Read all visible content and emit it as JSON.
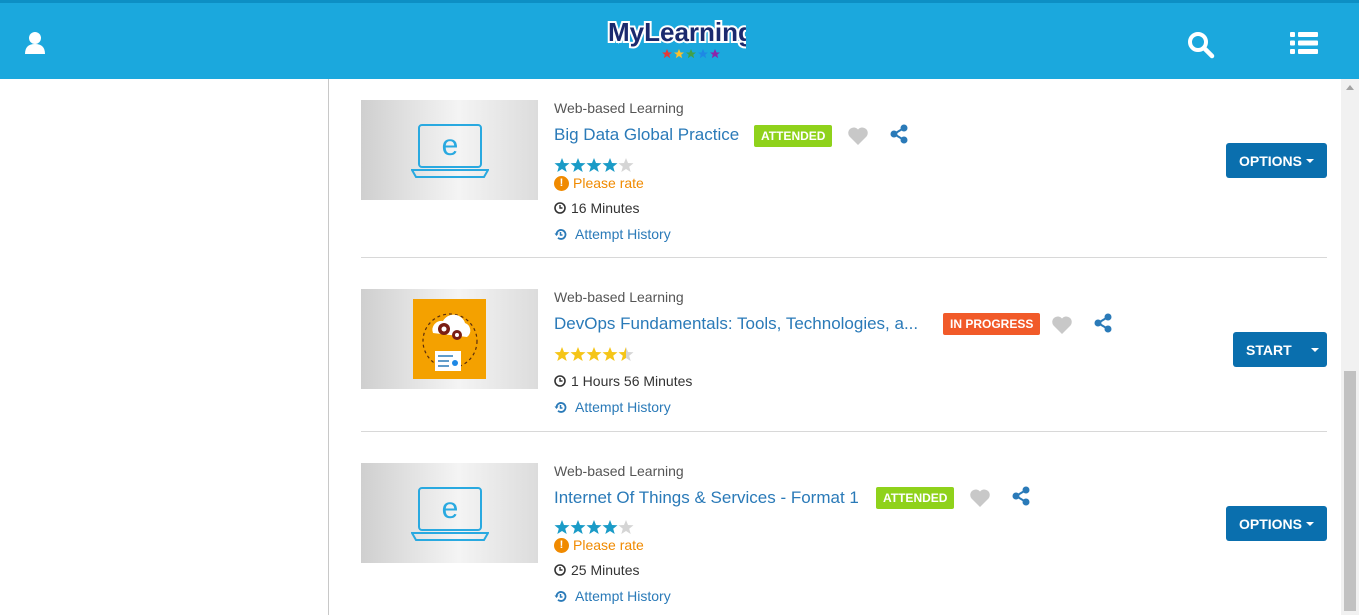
{
  "header": {
    "logo_text": "MyLearning",
    "brand_color": "#1ba8dd"
  },
  "courses": [
    {
      "type": "Web-based Learning",
      "title": "Big Data Global Practice",
      "status": "ATTENDED",
      "rating": 4,
      "rating_max": 5,
      "rate_prompt": "Please rate",
      "duration": "16 Minutes",
      "history": "Attempt History",
      "action": "OPTIONS",
      "thumbnail": "e-learning-laptop-icon"
    },
    {
      "type": "Web-based Learning",
      "title": "DevOps Fundamentals: Tools, Technologies, a...",
      "status": "IN PROGRESS",
      "rating": 4.5,
      "rating_max": 5,
      "duration": "1 Hours 56 Minutes",
      "history": "Attempt History",
      "action": "START",
      "thumbnail": "devops-cloud-gears-icon"
    },
    {
      "type": "Web-based Learning",
      "title": "Internet Of Things & Services - Format 1",
      "status": "ATTENDED",
      "rating": 4,
      "rating_max": 5,
      "rate_prompt": "Please rate",
      "duration": "25 Minutes",
      "history": "Attempt History",
      "action": "OPTIONS",
      "thumbnail": "e-learning-laptop-icon"
    }
  ]
}
